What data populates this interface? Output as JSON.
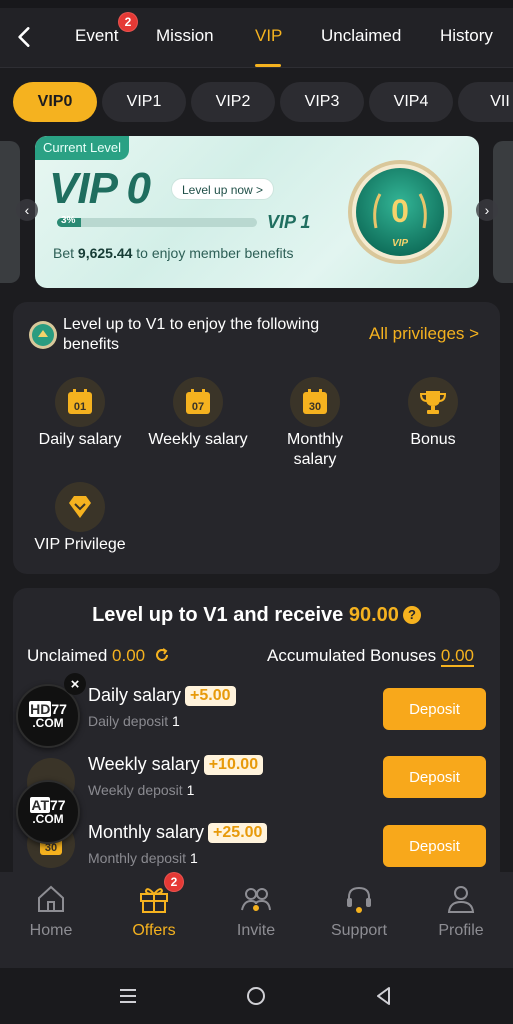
{
  "nav": {
    "tabs": [
      "Event",
      "Mission",
      "VIP",
      "Unclaimed",
      "History"
    ],
    "event_badge": "2",
    "active_tab": "VIP"
  },
  "levels": [
    "VIP0",
    "VIP1",
    "VIP2",
    "VIP3",
    "VIP4",
    "VII"
  ],
  "card": {
    "current_level_label": "Current Level",
    "level": "VIP 0",
    "level_up_button": "Level up now >",
    "progress_text": "3%",
    "progress_fraction": 0.03,
    "next_level": "VIP 1",
    "bet_prefix": "Bet ",
    "bet_amount": "9,625.44",
    "bet_suffix": " to enjoy member benefits",
    "coin_number": "0",
    "coin_label": "VIP"
  },
  "benefits": {
    "title": "Level up to V1 to enjoy the following benefits",
    "all_privileges": "All privileges >",
    "items": [
      {
        "label": "Daily salary",
        "icon_text": "01"
      },
      {
        "label": "Weekly salary",
        "icon_text": "07"
      },
      {
        "label": "Monthly salary",
        "icon_text": "30"
      },
      {
        "label": "Bonus"
      },
      {
        "label": "VIP Privilege"
      }
    ]
  },
  "levelup": {
    "title_prefix": "Level up to V1 and receive ",
    "amount": "90.00",
    "help": "?",
    "unclaimed_label": "Unclaimed ",
    "unclaimed_value": "0.00",
    "accumulated_label": "Accumulated Bonuses ",
    "accumulated_value": "0.00",
    "rows": [
      {
        "title": "Daily salary",
        "bonus": "+5.00",
        "sub_label": "Daily deposit ",
        "sub_value": "1",
        "button": "Deposit"
      },
      {
        "title": "Weekly salary",
        "bonus": "+10.00",
        "sub_label": "Weekly deposit ",
        "sub_value": "1",
        "button": "Deposit"
      },
      {
        "title": "Monthly salary",
        "bonus": "+25.00",
        "sub_label": "Monthly deposit ",
        "sub_value": "1",
        "button": "Deposit"
      }
    ],
    "monthly_icon_text": "30"
  },
  "promos": [
    {
      "line1_a": "HD",
      "line1_b": "77",
      "line2": ".COM"
    },
    {
      "line1_a": "AT",
      "line1_b": "77",
      "line2": ".COM"
    }
  ],
  "promo_close": "×",
  "bottom_nav": {
    "items": [
      "Home",
      "Offers",
      "Invite",
      "Support",
      "Profile"
    ],
    "offers_badge": "2",
    "active": "Offers"
  },
  "colors": {
    "accent": "#f5b21f",
    "background": "#1c1c1f",
    "panel": "#26262b",
    "teal": "#2aa184",
    "badge": "#e53935"
  }
}
